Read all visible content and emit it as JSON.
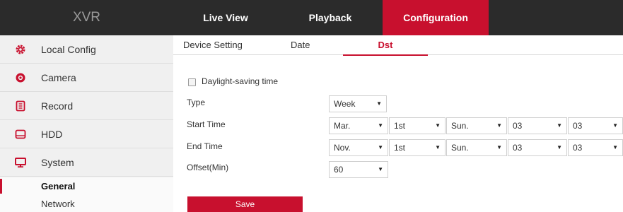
{
  "header": {
    "brand": "XVR",
    "tabs": [
      "Live View",
      "Playback",
      "Configuration"
    ]
  },
  "sidebar": {
    "items": [
      {
        "label": "Local Config",
        "icon": "gear-icon"
      },
      {
        "label": "Camera",
        "icon": "camera-icon"
      },
      {
        "label": "Record",
        "icon": "record-icon"
      },
      {
        "label": "HDD",
        "icon": "hdd-icon"
      },
      {
        "label": "System",
        "icon": "monitor-icon"
      }
    ],
    "sub_items": [
      "General",
      "Network"
    ]
  },
  "content": {
    "tabs": [
      "Device Setting",
      "Date",
      "Dst"
    ],
    "dst_checkbox_label": "Daylight-saving time",
    "labels": {
      "type": "Type",
      "start_time": "Start Time",
      "end_time": "End Time",
      "offset": "Offset(Min)"
    },
    "type_value": "Week",
    "start": {
      "month": "Mar.",
      "week": "1st",
      "day": "Sun.",
      "hour": "03",
      "minute": "03"
    },
    "end": {
      "month": "Nov.",
      "week": "1st",
      "day": "Sun.",
      "hour": "03",
      "minute": "03"
    },
    "offset_value": "60",
    "save_label": "Save"
  },
  "colors": {
    "accent": "#c8102e",
    "topbar": "#2b2b2b",
    "sidebar": "#f0f0f0"
  }
}
